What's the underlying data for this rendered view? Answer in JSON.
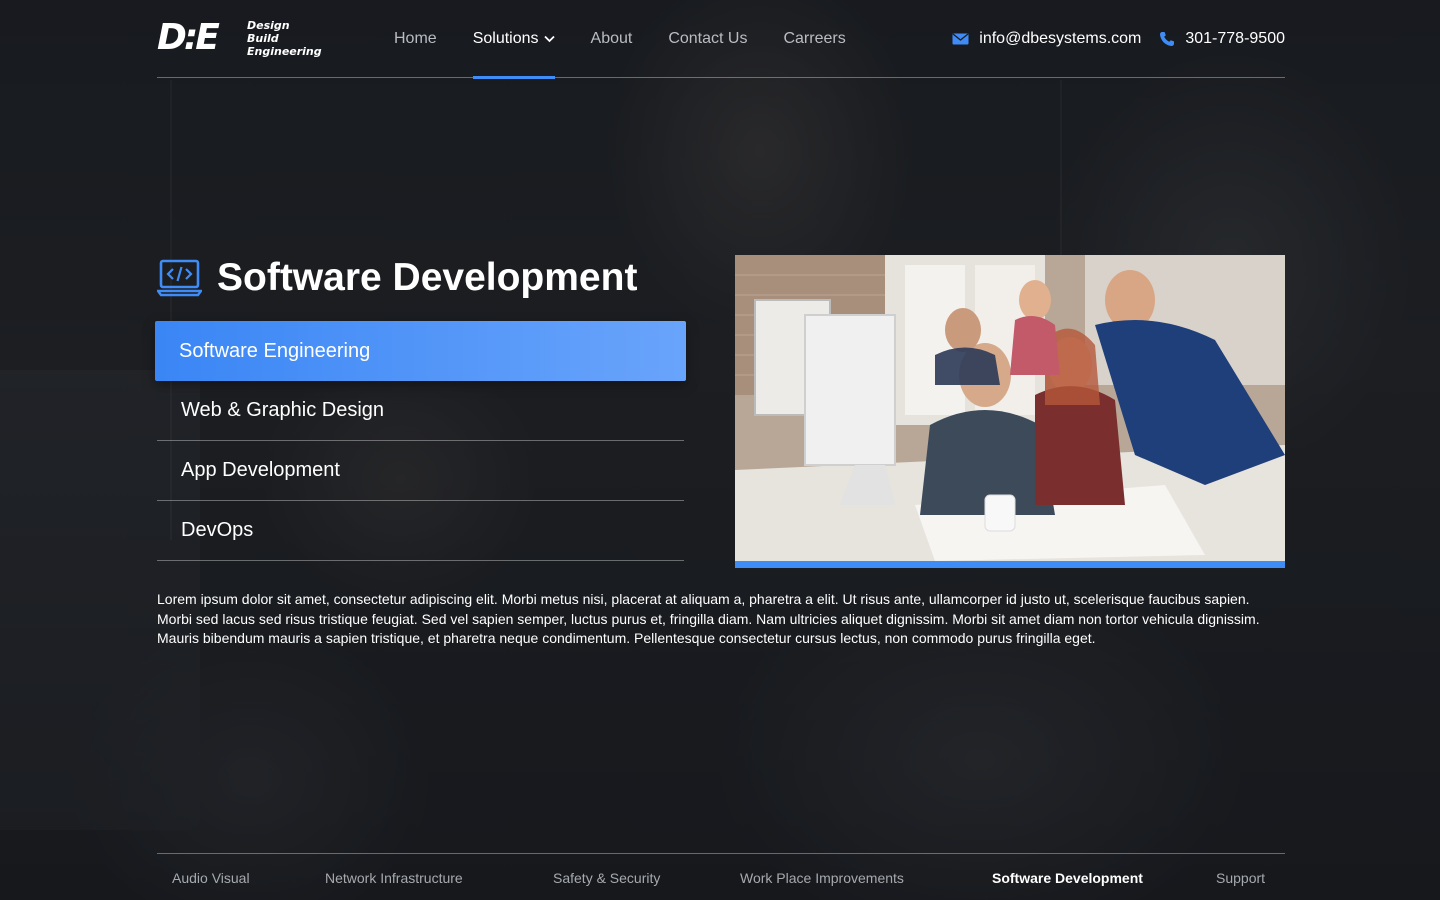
{
  "brand": {
    "logo_mark": "D:E",
    "logo_lines": [
      "Design",
      "Build",
      "Engineering"
    ]
  },
  "nav": {
    "items": [
      {
        "label": "Home"
      },
      {
        "label": "Solutions"
      },
      {
        "label": "About"
      },
      {
        "label": "Contact Us"
      },
      {
        "label": "Carreers"
      }
    ],
    "active": "Solutions"
  },
  "contact": {
    "email": "info@dbesystems.com",
    "phone": "301-778-9500"
  },
  "main": {
    "title": "Software Development",
    "title_icon": "code-laptop-icon",
    "submenu": [
      {
        "label": "Software Engineering",
        "active": true
      },
      {
        "label": "Web & Graphic Design",
        "active": false
      },
      {
        "label": "App Development",
        "active": false
      },
      {
        "label": "DevOps",
        "active": false
      }
    ],
    "paragraph": "Lorem ipsum dolor sit amet, consectetur adipiscing elit. Morbi metus nisi, placerat at aliquam a, pharetra a elit. Ut risus ante, ullamcorper id justo ut, scelerisque faucibus sapien. Morbi sed lacus sed risus tristique feugiat. Sed vel sapien semper, luctus purus et, fringilla diam. Nam ultricies aliquet dignissim. Morbi sit amet diam non tortor vehicula dignissim. Mauris bibendum mauris a sapien tristique, et pharetra neque condimentum. Pellentesque consectetur cursus lectus, non commodo purus fringilla eget."
  },
  "bottom_tabs": {
    "items": [
      {
        "label": "Audio Visual"
      },
      {
        "label": "Network Infrastructure"
      },
      {
        "label": "Safety & Security"
      },
      {
        "label": "Work Place Improvements"
      },
      {
        "label": "Software Development"
      },
      {
        "label": "Support"
      }
    ],
    "active": "Software Development"
  },
  "colors": {
    "accent": "#3f8cf6",
    "accent_light": "#69a4fb",
    "text": "#ffffff",
    "muted": "#b9bcc2"
  }
}
